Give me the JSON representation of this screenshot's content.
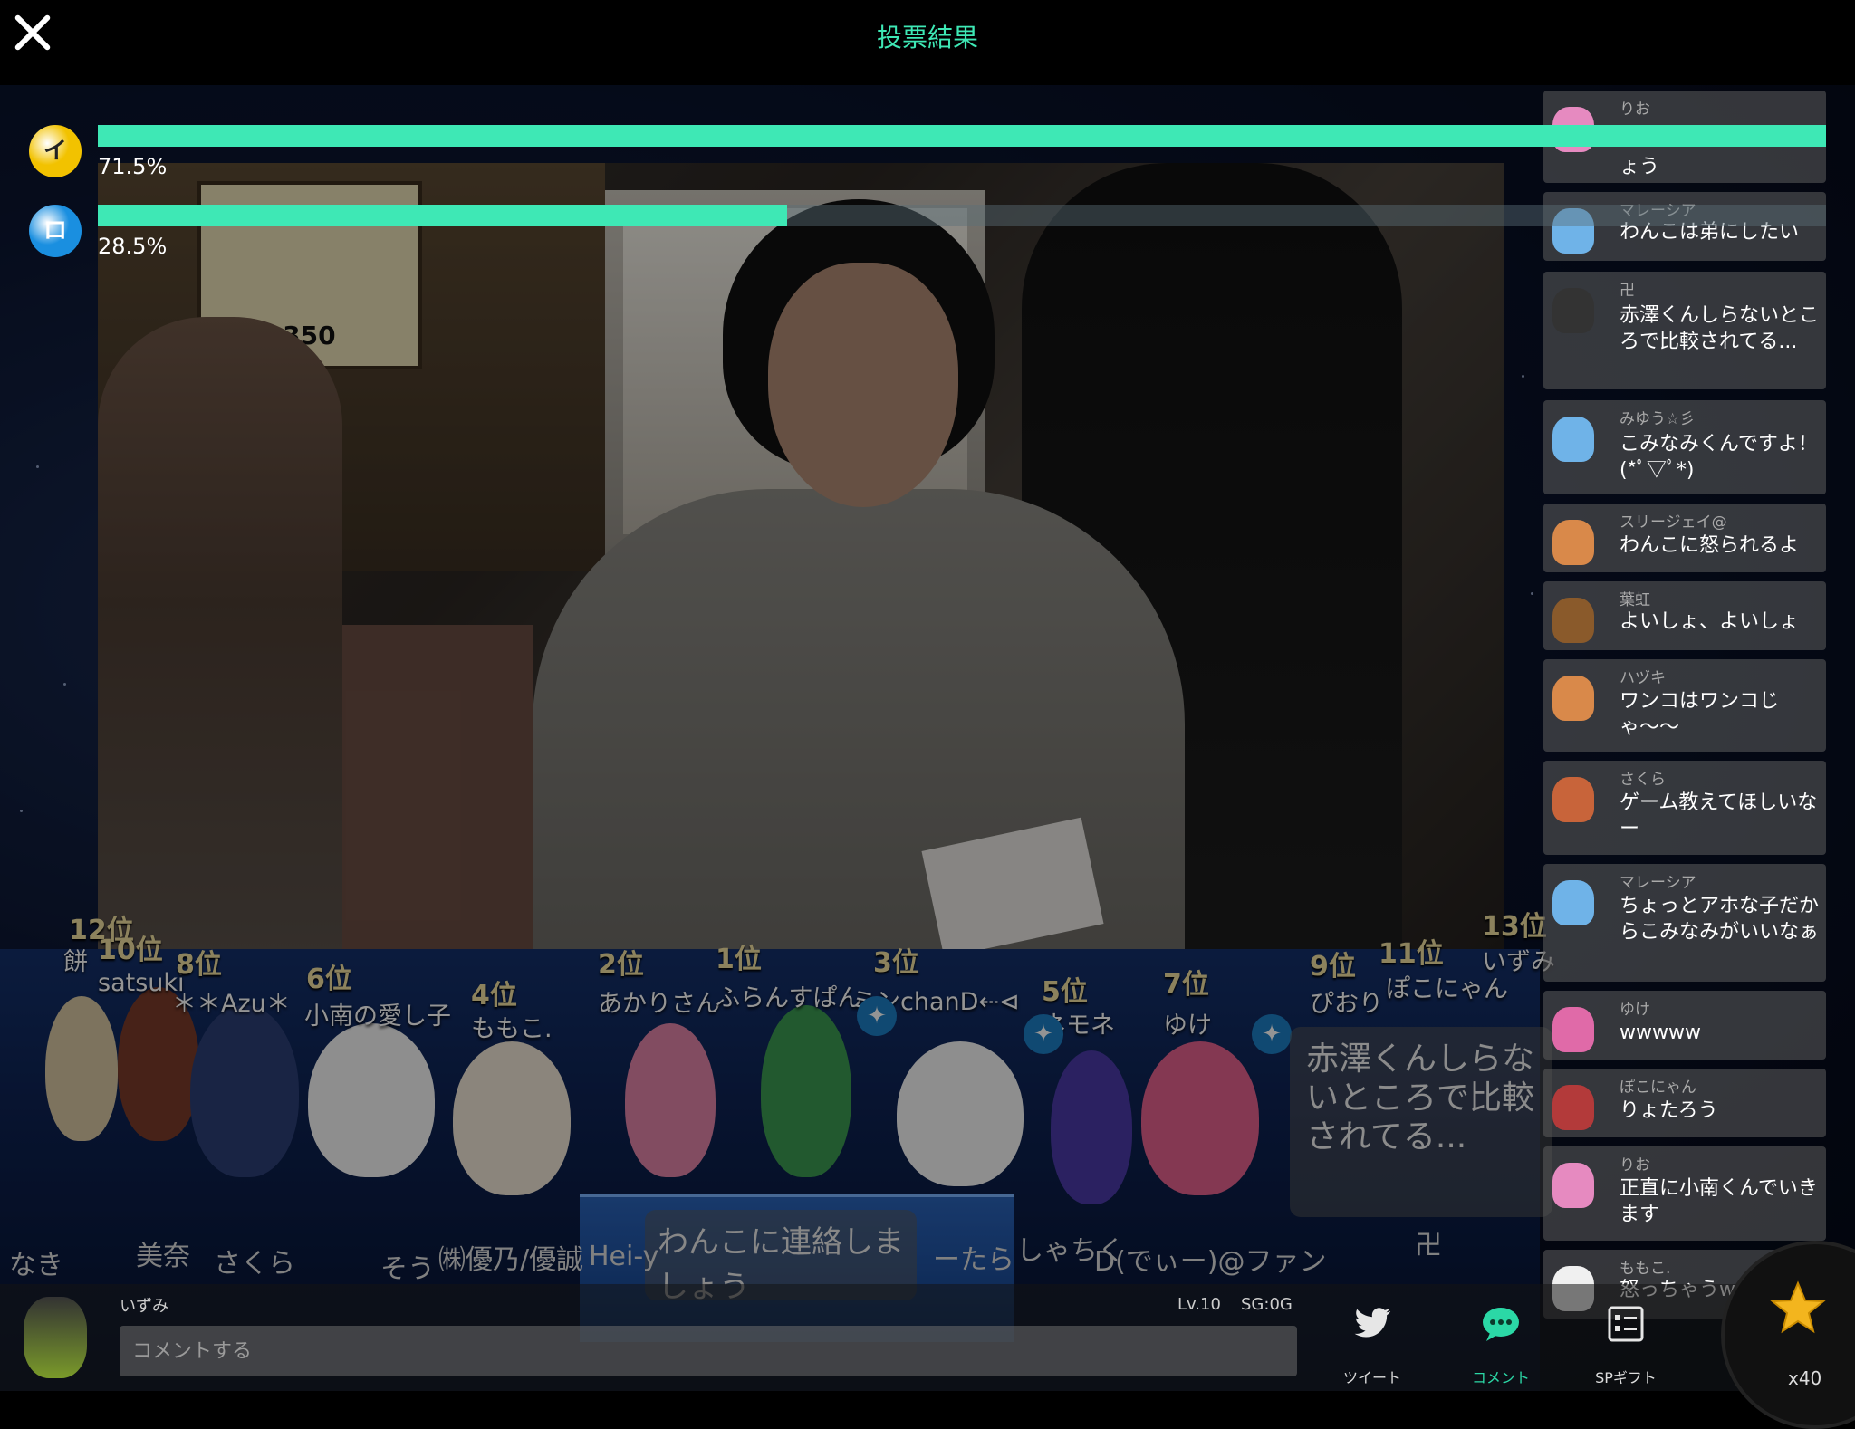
{
  "header": {
    "title": "投票結果",
    "close_label": ""
  },
  "poll": {
    "options": [
      {
        "icon_label": "イ",
        "percent_label": "71.5%",
        "percent": 71.5,
        "color": "#f2c200"
      },
      {
        "icon_label": "ロ",
        "percent_label": "28.5%",
        "percent": 28.5,
        "color": "#1a8fe0"
      }
    ],
    "bar_color": "#3ee8b5"
  },
  "video": {
    "menu_price": "2,350"
  },
  "ranking": [
    {
      "rank": "12位",
      "name": "餅"
    },
    {
      "rank": "10位",
      "name": "satsuki"
    },
    {
      "rank": "8位",
      "name": "＊＊Azu＊"
    },
    {
      "rank": "6位",
      "name": "小南の愛し子"
    },
    {
      "rank": "4位",
      "name": "ももこ."
    },
    {
      "rank": "2位",
      "name": "あかりさん"
    },
    {
      "rank": "1位",
      "name": "ふらんすぱん"
    },
    {
      "rank": "3位",
      "name": "ミンchanD⇠⊲"
    },
    {
      "rank": "5位",
      "name": "ネモネ"
    },
    {
      "rank": "7位",
      "name": "ゆけ"
    },
    {
      "rank": "9位",
      "name": "ぴおり"
    },
    {
      "rank": "11位",
      "name": "ぽこにゃん"
    },
    {
      "rank": "13位",
      "name": "いずみ"
    }
  ],
  "stage_bubbles": {
    "center": "わんこに連絡しましょう",
    "right": "赤澤くんしらないところで比較されてる..."
  },
  "bottom_names": [
    "なき",
    "美奈",
    "さくら",
    "そう",
    "㈱優乃/優誠",
    "Hei-y",
    "ーたら",
    "しゃちく",
    "D(でぃー)@ファン",
    "卍"
  ],
  "comments": [
    {
      "user": "りお",
      "text": "ょう",
      "avatar_color": "#e68ac0"
    },
    {
      "user": "マレーシア",
      "text": "わんこは弟にしたい",
      "avatar_color": "#6fb3e8"
    },
    {
      "user": "卍",
      "text": "赤澤くんしらないところで比較されてる...",
      "avatar_color": "#333333"
    },
    {
      "user": "みゆう☆彡",
      "text": "こみなみくんですよ！(*ﾟ▽ﾟ*)",
      "avatar_color": "#6fb3e8"
    },
    {
      "user": "スリージェイ@",
      "text": "わんこに怒られるよ",
      "avatar_color": "#d9894a"
    },
    {
      "user": "葉虹",
      "text": "よいしょ、よいしょ",
      "avatar_color": "#8a5a2b"
    },
    {
      "user": "ハヅキ",
      "text": "ワンコはワンコじゃ〜〜",
      "avatar_color": "#d9894a"
    },
    {
      "user": "さくら",
      "text": "ゲーム教えてほしいなー",
      "avatar_color": "#c8643a"
    },
    {
      "user": "マレーシア",
      "text": "ちょっとアホな子だからこみなみがいいなぁ",
      "avatar_color": "#6fb3e8"
    },
    {
      "user": "ゆけ",
      "text": "wwwww",
      "avatar_color": "#e06aa8"
    },
    {
      "user": "ぽこにゃん",
      "text": "りょたろう",
      "avatar_color": "#b33a3a"
    },
    {
      "user": "りお",
      "text": "正直に小南くんでいきます",
      "avatar_color": "#e68ac0"
    },
    {
      "user": "ももこ.",
      "text": "怒っちゃうw",
      "avatar_color": "#f0f0f0"
    }
  ],
  "bottom_bar": {
    "user_name": "いずみ",
    "level": "Lv.10",
    "sg": "SG:0G",
    "comment_placeholder": "コメントする",
    "tweet_label": "ツイート",
    "comment_label": "コメント",
    "sp_gift_label": "SPギフト",
    "star_count": "x40"
  }
}
